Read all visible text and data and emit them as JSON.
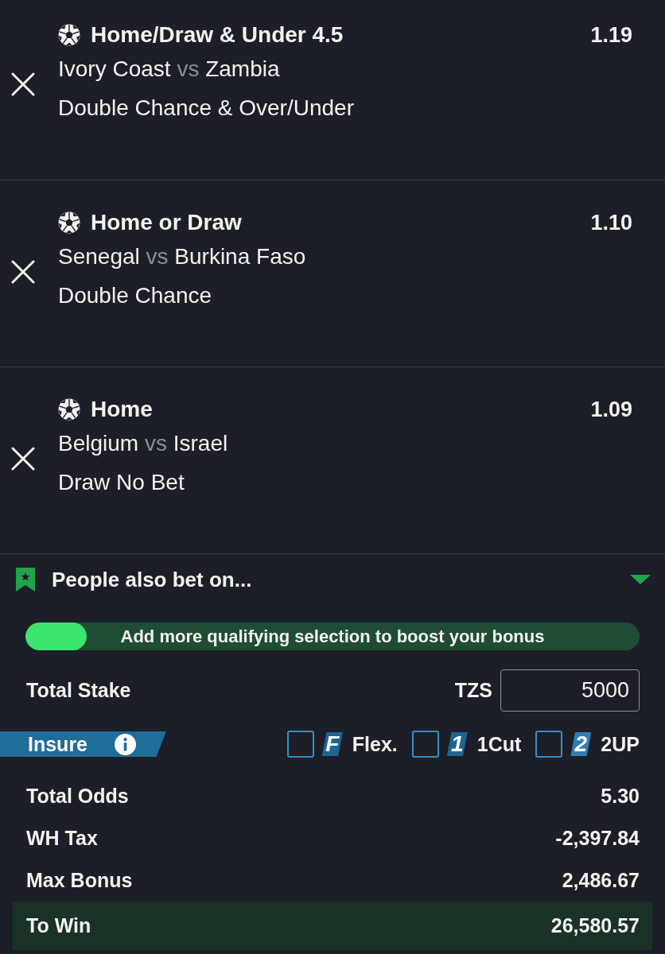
{
  "bets": [
    {
      "selection": "Home/Draw & Under 4.5",
      "odds": "1.19",
      "home": "Ivory Coast",
      "separator": "vs",
      "away": "Zambia",
      "market": "Double Chance & Over/Under"
    },
    {
      "selection": "Home or Draw",
      "odds": "1.10",
      "home": "Senegal",
      "separator": "vs",
      "away": "Burkina Faso",
      "market": "Double Chance"
    },
    {
      "selection": "Home",
      "odds": "1.09",
      "home": "Belgium",
      "separator": "vs",
      "away": "Israel",
      "market": "Draw No Bet"
    }
  ],
  "also_bet": {
    "label": "People also bet on...",
    "expanded": false
  },
  "bonus_bar": {
    "level": 0.1,
    "message": "Add more qualifying selection to boost your bonus"
  },
  "stake": {
    "label": "Total Stake",
    "currency": "TZS",
    "value": "5000"
  },
  "insure": {
    "label": "Insure"
  },
  "options": [
    {
      "kind": "flex",
      "badge": "F",
      "label": "Flex.",
      "checked": false
    },
    {
      "kind": "cut",
      "badge": "1",
      "label": "1Cut",
      "checked": false
    },
    {
      "kind": "up",
      "badge": "2",
      "label": "2UP",
      "checked": false
    }
  ],
  "summary": [
    {
      "label": "Total Odds",
      "value": "5.30"
    },
    {
      "label": "WH Tax",
      "value": "-2,397.84"
    },
    {
      "label": "Max Bonus",
      "value": "2,486.67"
    }
  ],
  "to_win": {
    "label": "To Win",
    "value": "26,580.57"
  }
}
